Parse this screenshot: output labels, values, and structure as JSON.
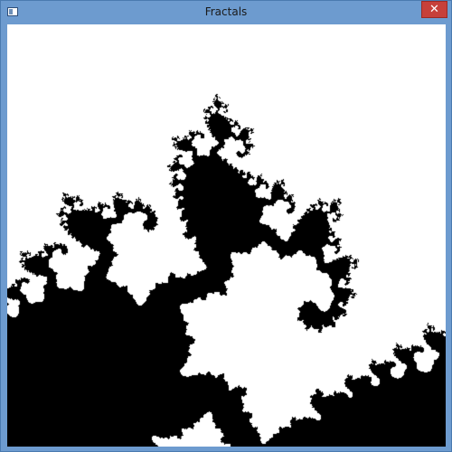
{
  "window": {
    "title": "Fractals",
    "close_glyph": "✕"
  },
  "fractal": {
    "type": "julia-set",
    "colors": {
      "inside": "#000000",
      "outside": "#ffffff",
      "titlebar": "#6d9bcf",
      "close_button": "#c7403a"
    }
  },
  "icons": {
    "app": "window-app-icon",
    "close": "close-icon"
  }
}
